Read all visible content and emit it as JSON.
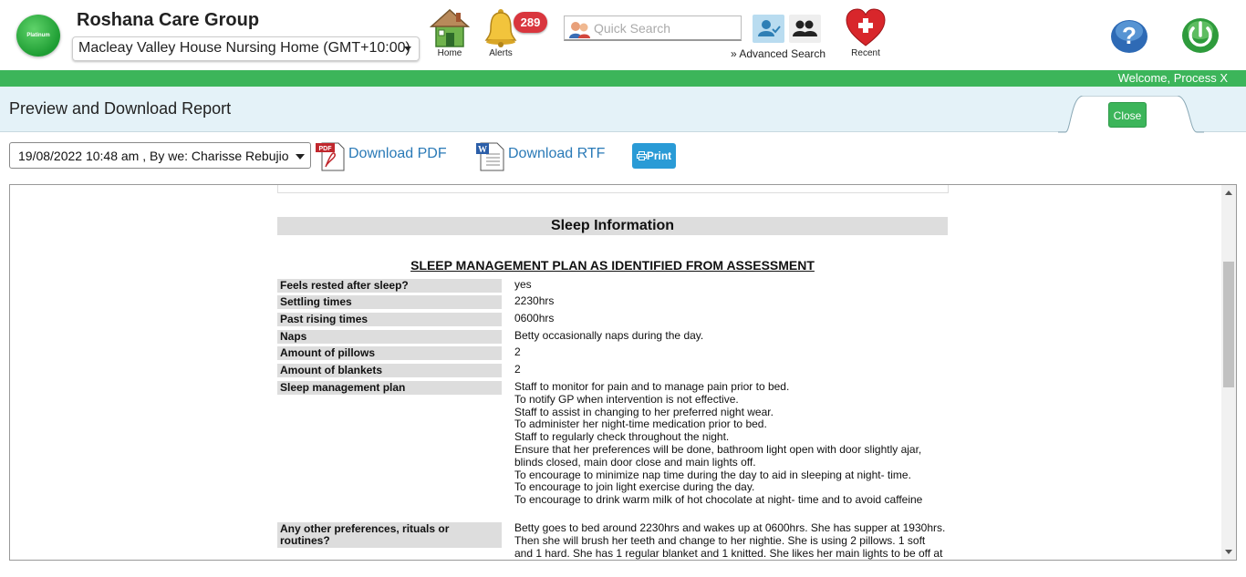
{
  "header": {
    "logo_text": "Platinum",
    "org_name": "Roshana Care Group",
    "facility": "Macleay Valley House Nursing Home (GMT+10:00)",
    "home_label": "Home",
    "alerts_label": "Alerts",
    "alerts_count": "289",
    "search_placeholder": "Quick Search",
    "advanced_search_label": "Advanced Search",
    "advanced_search_prefix": "»",
    "recent_label": "Recent",
    "welcome": "Welcome, Process X"
  },
  "page": {
    "title": "Preview and Download Report",
    "close_label": "Close"
  },
  "toolbar": {
    "version": "19/08/2022 10:48 am , By we: Charisse Rebujio",
    "download_pdf": "Download PDF",
    "download_rtf": "Download RTF",
    "print": "Print",
    "pdf_icon_text": "PDF"
  },
  "report": {
    "section_title": "Sleep Information",
    "plan_title": "SLEEP MANAGEMENT PLAN AS IDENTIFIED FROM ASSESSMENT",
    "rows": [
      {
        "label": "Feels rested after sleep?",
        "value": "yes"
      },
      {
        "label": "Settling times",
        "value": "2230hrs"
      },
      {
        "label": "Past rising times",
        "value": "0600hrs"
      },
      {
        "label": "Naps",
        "value": "Betty occasionally naps during the day."
      },
      {
        "label": "Amount of pillows",
        "value": "2"
      },
      {
        "label": "Amount of blankets",
        "value": "2"
      }
    ],
    "plan_label": "Sleep management plan",
    "plan_lines": [
      "Staff to monitor for pain and to manage pain prior to bed.",
      "To notify GP when intervention is not effective.",
      "Staff to assist in changing to her preferred night wear.",
      "To administer her night-time medication prior to bed.",
      "Staff to regularly check throughout the night.",
      "Ensure that her preferences will be done, bathroom light open with door slightly ajar,",
      "blinds closed, main door close and main lights off.",
      "To encourage to minimize nap time during the day to aid in sleeping at night- time.",
      "To encourage to join light exercise during the day.",
      "To encourage to drink warm milk of hot chocolate at night- time and to avoid caffeine"
    ],
    "other_label_1": "Any other preferences, rituals or",
    "other_label_2": "routines?",
    "other_lines": [
      "Betty goes to bed around 2230hrs and wakes up at 0600hrs. She has supper at 1930hrs.",
      "Then she will brush her teeth and change to her nightie. She is using 2 pillows. 1 soft",
      "and 1 hard. She has 1 regular blanket and 1 knitted. She likes her main lights to be off at"
    ]
  }
}
